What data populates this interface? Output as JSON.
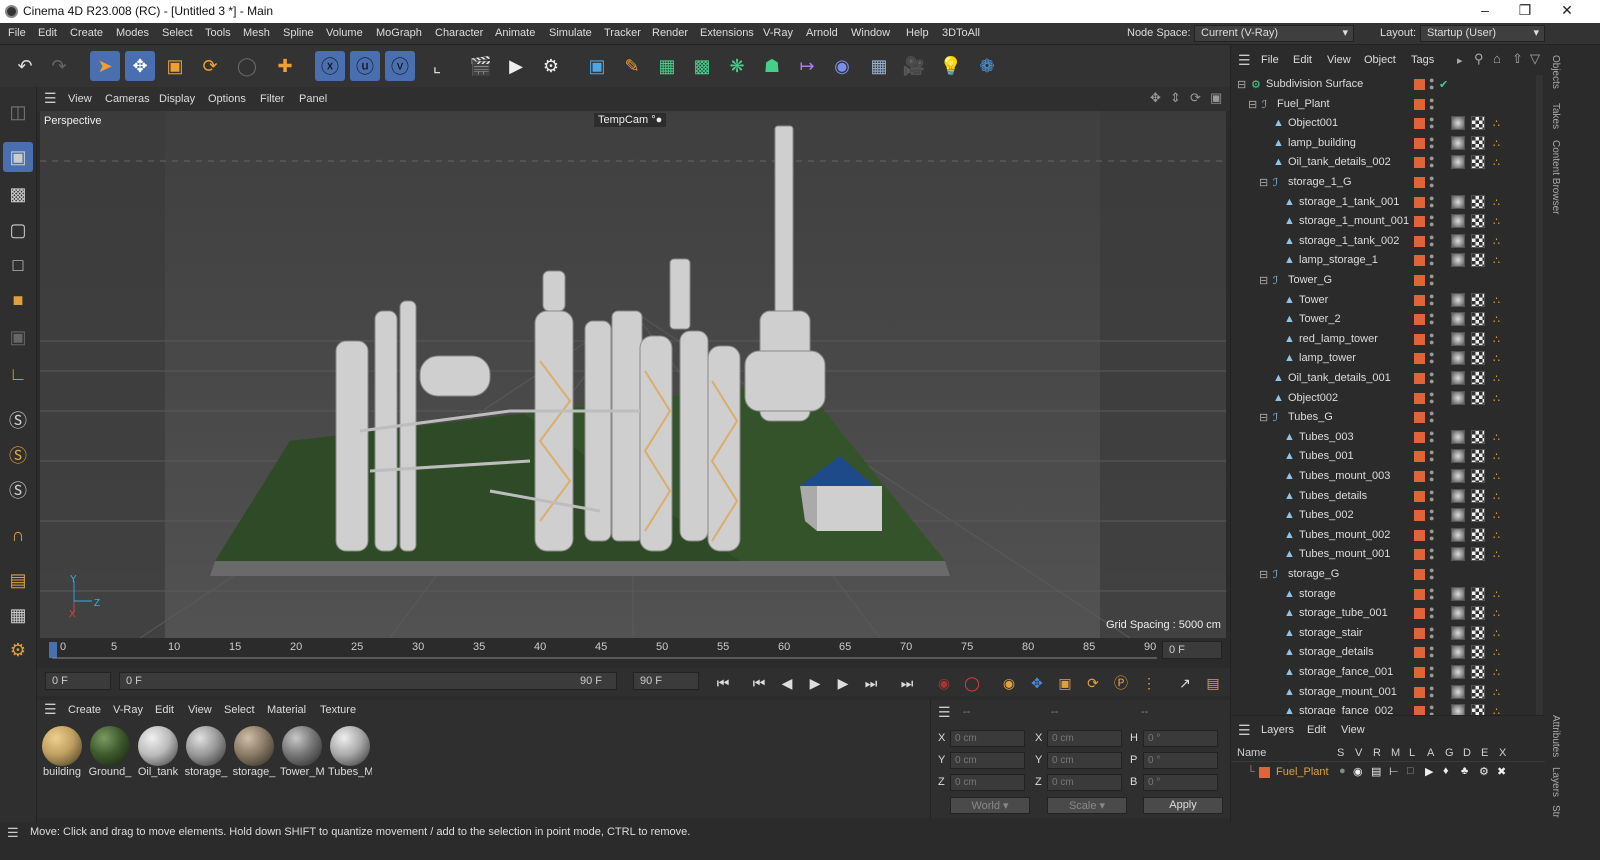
{
  "window": {
    "title": "Cinema 4D R23.008 (RC) - [Untitled 3 *] - Main"
  },
  "menu": [
    "File",
    "Edit",
    "Create",
    "Modes",
    "Select",
    "Tools",
    "Mesh",
    "Spline",
    "Volume",
    "MoGraph",
    "Character",
    "Animate",
    "Simulate",
    "Tracker",
    "Render",
    "Extensions",
    "V-Ray",
    "Arnold",
    "Window",
    "Help",
    "3DToAll"
  ],
  "node_space": {
    "label": "Node Space:",
    "value": "Current (V-Ray)"
  },
  "layout": {
    "label": "Layout:",
    "value": "Startup (User)"
  },
  "viewport": {
    "menu": [
      "View",
      "Cameras",
      "Display",
      "Options",
      "Filter",
      "Panel"
    ],
    "projection": "Perspective",
    "camera": "TempCam",
    "grid_spacing": "Grid Spacing : 5000 cm"
  },
  "timeline": {
    "ticks": [
      "0",
      "5",
      "10",
      "15",
      "20",
      "25",
      "30",
      "35",
      "40",
      "45",
      "50",
      "55",
      "60",
      "65",
      "70",
      "75",
      "80",
      "85",
      "90"
    ],
    "current_frame": "0 F",
    "start_field": "0 F",
    "range_start": "0 F",
    "range_end": "90 F",
    "end_field": "90 F"
  },
  "materials": {
    "menu": [
      "Create",
      "V-Ray",
      "Edit",
      "View",
      "Select",
      "Material",
      "Texture"
    ],
    "items": [
      {
        "label": "building",
        "color": "#c0a060"
      },
      {
        "label": "Ground_",
        "color": "#3e5a2e"
      },
      {
        "label": "Oil_tank",
        "color": "#bbbbbb"
      },
      {
        "label": "storage_",
        "color": "#999999"
      },
      {
        "label": "storage_",
        "color": "#8a7a66"
      },
      {
        "label": "Tower_M",
        "color": "#777777"
      },
      {
        "label": "Tubes_M",
        "color": "#aaaaaa"
      }
    ]
  },
  "coordinates": {
    "header": [
      "--",
      "--",
      "--"
    ],
    "rows": [
      {
        "a": "X",
        "av": "0 cm",
        "b": "X",
        "bv": "0 cm",
        "c": "H",
        "cv": "0 °"
      },
      {
        "a": "Y",
        "av": "0 cm",
        "b": "Y",
        "bv": "0 cm",
        "c": "P",
        "cv": "0 °"
      },
      {
        "a": "Z",
        "av": "0 cm",
        "b": "Z",
        "bv": "0 cm",
        "c": "B",
        "cv": "0 °"
      }
    ],
    "mode": "World",
    "size_mode": "Scale",
    "apply": "Apply"
  },
  "objects": {
    "menu": [
      "File",
      "Edit",
      "View",
      "Object",
      "Tags"
    ],
    "rows": [
      {
        "name": "Subdivision Surface",
        "depth": 0,
        "group": true
      },
      {
        "name": "Fuel_Plant",
        "depth": 1,
        "group": true
      },
      {
        "name": "Object001",
        "depth": 2
      },
      {
        "name": "lamp_building",
        "depth": 2
      },
      {
        "name": "Oil_tank_details_002",
        "depth": 2
      },
      {
        "name": "storage_1_G",
        "depth": 2,
        "group": true
      },
      {
        "name": "storage_1_tank_001",
        "depth": 3
      },
      {
        "name": "storage_1_mount_001",
        "depth": 3
      },
      {
        "name": "storage_1_tank_002",
        "depth": 3
      },
      {
        "name": "lamp_storage_1",
        "depth": 3
      },
      {
        "name": "Tower_G",
        "depth": 2,
        "group": true
      },
      {
        "name": "Tower",
        "depth": 3
      },
      {
        "name": "Tower_2",
        "depth": 3
      },
      {
        "name": "red_lamp_tower",
        "depth": 3
      },
      {
        "name": "lamp_tower",
        "depth": 3
      },
      {
        "name": "Oil_tank_details_001",
        "depth": 2
      },
      {
        "name": "Object002",
        "depth": 2
      },
      {
        "name": "Tubes_G",
        "depth": 2,
        "group": true
      },
      {
        "name": "Tubes_003",
        "depth": 3
      },
      {
        "name": "Tubes_001",
        "depth": 3
      },
      {
        "name": "Tubes_mount_003",
        "depth": 3
      },
      {
        "name": "Tubes_details",
        "depth": 3
      },
      {
        "name": "Tubes_002",
        "depth": 3
      },
      {
        "name": "Tubes_mount_002",
        "depth": 3
      },
      {
        "name": "Tubes_mount_001",
        "depth": 3
      },
      {
        "name": "storage_G",
        "depth": 2,
        "group": true
      },
      {
        "name": "storage",
        "depth": 3
      },
      {
        "name": "storage_tube_001",
        "depth": 3
      },
      {
        "name": "storage_stair",
        "depth": 3
      },
      {
        "name": "storage_details",
        "depth": 3
      },
      {
        "name": "storage_fance_001",
        "depth": 3
      },
      {
        "name": "storage_mount_001",
        "depth": 3
      },
      {
        "name": "storage_fance_002",
        "depth": 3
      }
    ]
  },
  "layers": {
    "menu": [
      "Layers",
      "Edit",
      "View"
    ],
    "columns": [
      "Name",
      "S",
      "V",
      "R",
      "M",
      "L",
      "A",
      "G",
      "D",
      "E",
      "X"
    ],
    "items": [
      {
        "name": "Fuel_Plant",
        "color": "#e0643a"
      }
    ]
  },
  "side_tabs": [
    "Objects",
    "Takes",
    "Content Browser",
    "Attributes",
    "Layers",
    "Str"
  ],
  "status": "Move: Click and drag to move elements. Hold down SHIFT to quantize movement / add to the selection in point mode, CTRL to remove."
}
